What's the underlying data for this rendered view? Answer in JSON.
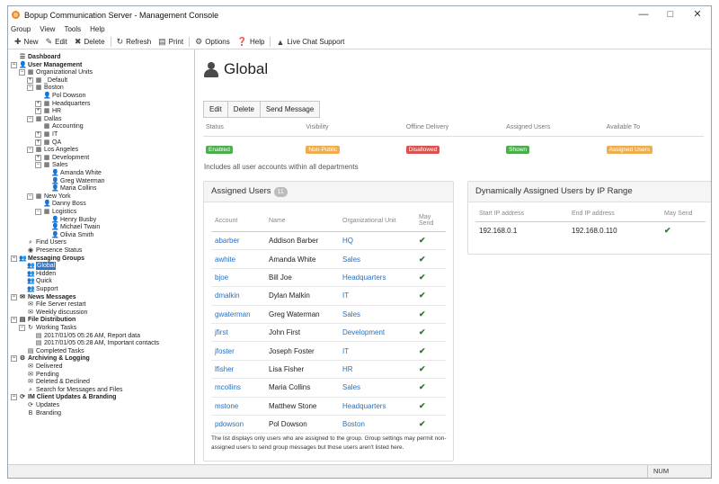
{
  "window": {
    "title": "Bopup Communication Server - Management Console",
    "minimize_glyph": "—",
    "maximize_glyph": "□",
    "close_glyph": "✕"
  },
  "menu": {
    "items": [
      "Group",
      "View",
      "Tools",
      "Help"
    ]
  },
  "toolbar": {
    "new": "New",
    "edit": "Edit",
    "delete": "Delete",
    "refresh": "Refresh",
    "print": "Print",
    "options": "Options",
    "help": "Help",
    "live_chat": "Live Chat Support"
  },
  "tree": [
    {
      "label": "Dashboard",
      "bold": true,
      "icon": "dashboard-icon",
      "glyph": "☰",
      "level": 0
    },
    {
      "label": "User Management",
      "bold": true,
      "icon": "user-icon",
      "glyph": "👤",
      "level": 0,
      "expander": "−"
    },
    {
      "label": "Organizational Units",
      "icon": "building-icon",
      "glyph": "▦",
      "level": 1,
      "expander": "−"
    },
    {
      "label": "_Default",
      "icon": "building-icon",
      "glyph": "▦",
      "level": 2,
      "expander": "+"
    },
    {
      "label": "Boston",
      "icon": "building-icon",
      "glyph": "▦",
      "level": 2,
      "expander": "−"
    },
    {
      "label": "Pol Dowson",
      "icon": "user-icon",
      "glyph": "👤",
      "level": 3
    },
    {
      "label": "Headquarters",
      "icon": "building-icon",
      "glyph": "▦",
      "level": 3,
      "expander": "+"
    },
    {
      "label": "HR",
      "icon": "building-icon",
      "glyph": "▦",
      "level": 3,
      "expander": "+"
    },
    {
      "label": "Dallas",
      "icon": "building-icon",
      "glyph": "▦",
      "level": 2,
      "expander": "−"
    },
    {
      "label": "Accounting",
      "icon": "building-icon",
      "glyph": "▦",
      "level": 3
    },
    {
      "label": "IT",
      "icon": "building-icon",
      "glyph": "▦",
      "level": 3,
      "expander": "+"
    },
    {
      "label": "QA",
      "icon": "building-icon",
      "glyph": "▦",
      "level": 3,
      "expander": "+"
    },
    {
      "label": "Los Angeles",
      "icon": "building-icon",
      "glyph": "▦",
      "level": 2,
      "expander": "−"
    },
    {
      "label": "Development",
      "icon": "building-icon",
      "glyph": "▦",
      "level": 3,
      "expander": "+"
    },
    {
      "label": "Sales",
      "icon": "building-icon",
      "glyph": "▦",
      "level": 3,
      "expander": "−"
    },
    {
      "label": "Amanda White",
      "icon": "user-icon",
      "glyph": "👤",
      "level": 4
    },
    {
      "label": "Greg Waterman",
      "icon": "user-icon",
      "glyph": "👤",
      "level": 4
    },
    {
      "label": "Maria Collins",
      "icon": "user-icon",
      "glyph": "👤",
      "level": 4
    },
    {
      "label": "New York",
      "icon": "building-icon",
      "glyph": "▦",
      "level": 2,
      "expander": "−"
    },
    {
      "label": "Danny Boss",
      "icon": "user-icon",
      "glyph": "👤",
      "level": 3
    },
    {
      "label": "Logistics",
      "icon": "building-icon",
      "glyph": "▦",
      "level": 3,
      "expander": "−"
    },
    {
      "label": "Henry Busby",
      "icon": "user-icon",
      "glyph": "👤",
      "level": 4
    },
    {
      "label": "Michael Twain",
      "icon": "user-icon",
      "glyph": "👤",
      "level": 4
    },
    {
      "label": "Olivia Smith",
      "icon": "user-icon",
      "glyph": "👤",
      "level": 4
    },
    {
      "label": "Find Users",
      "icon": "search-icon",
      "glyph": "⌕",
      "level": 1
    },
    {
      "label": "Presence Status",
      "icon": "presence-icon",
      "glyph": "◉",
      "level": 1
    },
    {
      "label": "Messaging Groups",
      "bold": true,
      "icon": "group-icon",
      "glyph": "👥",
      "level": 0,
      "expander": "−"
    },
    {
      "label": "Global",
      "icon": "group-icon",
      "glyph": "👥",
      "level": 1,
      "selected": true
    },
    {
      "label": "Hidden",
      "icon": "group-icon",
      "glyph": "👥",
      "level": 1
    },
    {
      "label": "Quick",
      "icon": "group-icon",
      "glyph": "👥",
      "level": 1
    },
    {
      "label": "Support",
      "icon": "group-icon",
      "glyph": "👥",
      "level": 1
    },
    {
      "label": "News Messages",
      "bold": true,
      "icon": "news-icon",
      "glyph": "✉",
      "level": 0,
      "expander": "−"
    },
    {
      "label": "File Server restart",
      "icon": "message-icon",
      "glyph": "✉",
      "level": 1
    },
    {
      "label": "Weekly discussion",
      "icon": "message-icon",
      "glyph": "✉",
      "level": 1
    },
    {
      "label": "File Distribution",
      "bold": true,
      "icon": "files-icon",
      "glyph": "▤",
      "level": 0,
      "expander": "−"
    },
    {
      "label": "Working Tasks",
      "icon": "task-icon",
      "glyph": "↻",
      "level": 1,
      "expander": "−"
    },
    {
      "label": "2017/01/05 05:26 AM, Report data",
      "icon": "task-icon",
      "glyph": "▤",
      "level": 2
    },
    {
      "label": "2017/01/05 05:28 AM, Important contacts",
      "icon": "task-icon",
      "glyph": "▤",
      "level": 2
    },
    {
      "label": "Completed Tasks",
      "icon": "task-icon",
      "glyph": "▤",
      "level": 1
    },
    {
      "label": "Archiving & Logging",
      "bold": true,
      "icon": "archive-icon",
      "glyph": "⚙",
      "level": 0,
      "expander": "−"
    },
    {
      "label": "Delivered",
      "icon": "message-icon",
      "glyph": "✉",
      "level": 1
    },
    {
      "label": "Pending",
      "icon": "message-icon",
      "glyph": "✉",
      "level": 1
    },
    {
      "label": "Deleted & Declined",
      "icon": "message-icon",
      "glyph": "✉",
      "level": 1
    },
    {
      "label": "Search for Messages and Files",
      "icon": "search-icon",
      "glyph": "⌕",
      "level": 1
    },
    {
      "label": "IM Client Updates & Branding",
      "bold": true,
      "icon": "updates-icon",
      "glyph": "⟳",
      "level": 0,
      "expander": "−"
    },
    {
      "label": "Updates",
      "icon": "updates-icon",
      "glyph": "⟳",
      "level": 1
    },
    {
      "label": "Branding",
      "icon": "branding-icon",
      "glyph": "B",
      "level": 1
    }
  ],
  "main": {
    "title": "Global",
    "buttons": {
      "edit": "Edit",
      "delete": "Delete",
      "send": "Send Message"
    },
    "status_headers": [
      "Status",
      "Visibility",
      "Offline Delivery",
      "Assigned Users",
      "Available To"
    ],
    "status_values": [
      {
        "text": "Enabled",
        "color": "#4cae4c"
      },
      {
        "text": "Non-Public",
        "color": "#f0ad4e"
      },
      {
        "text": "Disallowed",
        "color": "#d9534f"
      },
      {
        "text": "Shown",
        "color": "#4cae4c"
      },
      {
        "text": "Assigned Users",
        "color": "#f0ad4e"
      }
    ],
    "includes_text": "Includes all user accounts within all departments",
    "assigned": {
      "title": "Assigned Users",
      "count": "11",
      "headers": [
        "Account",
        "Name",
        "Organizational Unit",
        "May Send"
      ],
      "rows": [
        {
          "account": "abarber",
          "name": "Addison Barber",
          "ou": "HQ",
          "may_send": "✔"
        },
        {
          "account": "awhite",
          "name": "Amanda White",
          "ou": "Sales",
          "may_send": "✔"
        },
        {
          "account": "bjoe",
          "name": "Bill Joe",
          "ou": "Headquarters",
          "may_send": "✔"
        },
        {
          "account": "dmalkin",
          "name": "Dylan Malkin",
          "ou": "IT",
          "may_send": "✔"
        },
        {
          "account": "gwaterman",
          "name": "Greg Waterman",
          "ou": "Sales",
          "may_send": "✔"
        },
        {
          "account": "jfirst",
          "name": "John First",
          "ou": "Development",
          "may_send": "✔"
        },
        {
          "account": "jfoster",
          "name": "Joseph Foster",
          "ou": "IT",
          "may_send": "✔"
        },
        {
          "account": "lfisher",
          "name": "Lisa Fisher",
          "ou": "HR",
          "may_send": "✔"
        },
        {
          "account": "mcollins",
          "name": "Maria Collins",
          "ou": "Sales",
          "may_send": "✔"
        },
        {
          "account": "mstone",
          "name": "Matthew Stone",
          "ou": "Headquarters",
          "may_send": "✔"
        },
        {
          "account": "pdowson",
          "name": "Pol Dowson",
          "ou": "Boston",
          "may_send": "✔",
          "disabled": true
        }
      ],
      "note": "The list displays only users who are assigned to the group. Group settings may permit non-assigned users to send group messages but those users aren't listed here."
    },
    "ip_range": {
      "title": "Dynamically Assigned Users by IP Range",
      "headers": [
        "Start IP address",
        "End IP address",
        "May Send"
      ],
      "rows": [
        {
          "start": "192.168.0.1",
          "end": "192.168.0.110",
          "may_send": "✔"
        }
      ]
    }
  },
  "statusbar": {
    "num": "NUM"
  }
}
